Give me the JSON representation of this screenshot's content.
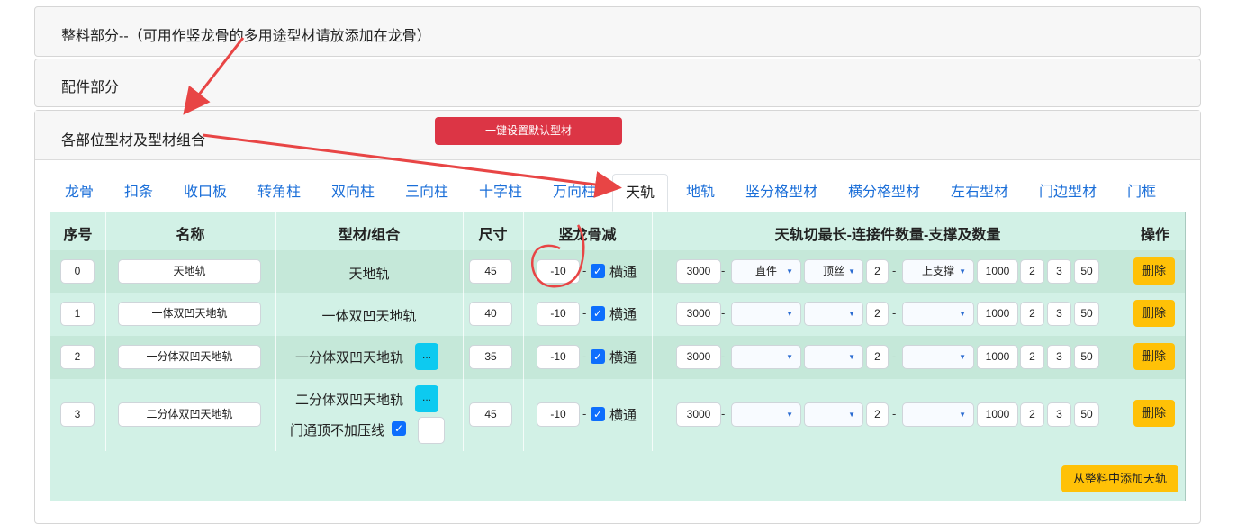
{
  "panels": {
    "p1_title": "整料部分--（可用作竖龙骨的多用途型材请放添加在龙骨）",
    "p2_title": "配件部分",
    "p3_title": "各部位型材及型材组合",
    "set_default_button": "一键设置默认型材"
  },
  "tabs": [
    "龙骨",
    "扣条",
    "收口板",
    "转角柱",
    "双向柱",
    "三向柱",
    "十字柱",
    "万向柱",
    "天轨",
    "地轨",
    "竖分格型材",
    "横分格型材",
    "左右型材",
    "门边型材",
    "门框"
  ],
  "active_tab": "天轨",
  "table": {
    "headers": [
      "序号",
      "名称",
      "型材/组合",
      "尺寸",
      "竖龙骨减",
      "天轨切最长-连接件数量-支撑及数量",
      "操作"
    ],
    "rows": [
      {
        "idx": "0",
        "name": "天地轨",
        "combo": "天地轨",
        "size": "45",
        "deduct": "-10",
        "check_label": "横通",
        "max_len": "3000",
        "conn": "直件",
        "sub": "顶丝",
        "n1": "2",
        "support": "上支撑",
        "v1": "1000",
        "v2": "2",
        "v3": "3",
        "v4": "50",
        "delete": "删除"
      },
      {
        "idx": "1",
        "name": "一体双凹天地轨",
        "combo": "一体双凹天地轨",
        "size": "40",
        "deduct": "-10",
        "check_label": "横通",
        "max_len": "3000",
        "conn": "",
        "sub": "",
        "n1": "2",
        "support": "",
        "v1": "1000",
        "v2": "2",
        "v3": "3",
        "v4": "50",
        "delete": "删除"
      },
      {
        "idx": "2",
        "name": "一分体双凹天地轨",
        "combo": "一分体双凹天地轨",
        "size": "35",
        "deduct": "-10",
        "check_label": "横通",
        "max_len": "3000",
        "conn": "",
        "sub": "",
        "n1": "2",
        "support": "",
        "v1": "1000",
        "v2": "2",
        "v3": "3",
        "v4": "50",
        "delete": "删除",
        "more": "..."
      },
      {
        "idx": "3",
        "name": "二分体双凹天地轨",
        "combo": "二分体双凹天地轨",
        "size": "45",
        "deduct": "-10",
        "check_label": "横通",
        "max_len": "3000",
        "conn": "",
        "sub": "",
        "n1": "2",
        "support": "",
        "v1": "1000",
        "v2": "2",
        "v3": "3",
        "v4": "50",
        "delete": "删除",
        "more": "...",
        "extra_label": "门通顶不加压线"
      }
    ]
  },
  "add_button": "从整料中添加天轨",
  "colors": {
    "annotation": "#e84545",
    "tab_link": "#1a6ed8",
    "danger": "#dc3545",
    "warning": "#ffc107",
    "info": "#0dcaf0",
    "checkbox": "#0d6efd"
  }
}
